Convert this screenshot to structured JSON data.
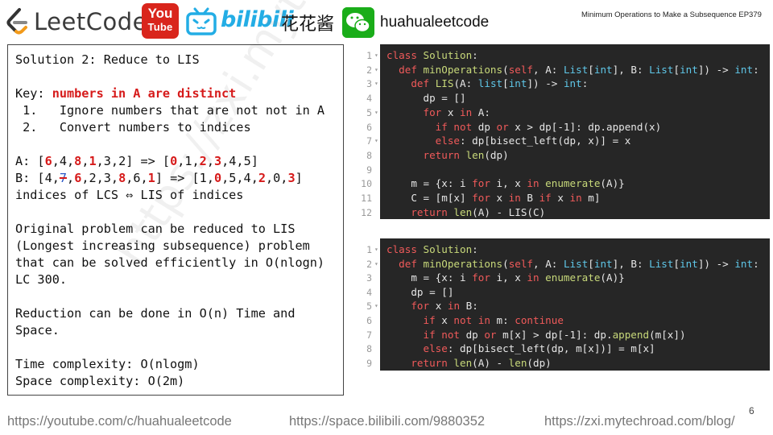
{
  "header": {
    "leetcode_text": "LeetCode",
    "youtube_top": "You",
    "youtube_bottom": "Tube",
    "bilibili_text": "bilibili",
    "channel_name": "花花酱",
    "handle": "huahualeetcode",
    "episode_title": "Minimum Operations to Make a Subsequence EP379"
  },
  "notes": {
    "title": "Solution 2: Reduce to LIS",
    "key_label": "Key: ",
    "key_value": "numbers in A are distinct",
    "step1": " 1.   Ignore numbers that are not not in A",
    "step2": " 2.   Convert numbers to indices",
    "line_a": {
      "p0": "A: [",
      "v0": "6",
      "c0": ",4,",
      "v1": "8",
      "c1": ",",
      "v2": "1",
      "p1": ",3,2] => [",
      "i0": "0",
      "c2": ",1,",
      "i1": "2",
      "c3": ",",
      "i2": "3",
      "p2": ",4,5]"
    },
    "line_b": {
      "p0": "B: [4,",
      "v0": "7",
      "c0": ",",
      "v1": "6",
      "c1": ",2,3,",
      "v2": "8",
      "c2": ",6,",
      "v3": "1",
      "p1": "] => [1,",
      "i0": "0",
      "c3": ",5,4,",
      "i1": "2",
      "c4": ",0,",
      "i2": "3",
      "p2": "]"
    },
    "lcs_line": "indices of LCS ⇔ LIS of indices",
    "para1": [
      "Original problem can be reduced to LIS",
      "(Longest increasing subsequence) problem",
      "that can be solved efficiently in O(nlogn)",
      "LC 300."
    ],
    "para2": [
      "Reduction can be done in O(n) Time and",
      "Space."
    ],
    "time": "Time complexity: O(nlogm)",
    "space": "Space complexity: O(2m)"
  },
  "watermark": "https://zxi.mytechroad.com 花花酱 LeetCode",
  "code1": {
    "line_numbers": [
      "1",
      "2",
      "3",
      "4",
      "5",
      "6",
      "7",
      "8",
      "9",
      "10",
      "11",
      "12"
    ],
    "lines": [
      [
        [
          "kw",
          "class "
        ],
        [
          "fn",
          "Solution"
        ],
        [
          "pl",
          ":"
        ]
      ],
      [
        [
          "pl",
          "  "
        ],
        [
          "kw",
          "def "
        ],
        [
          "fn",
          "minOperations"
        ],
        [
          "pl",
          "("
        ],
        [
          "kw",
          "self"
        ],
        [
          "pl",
          ", A: "
        ],
        [
          "ty",
          "List"
        ],
        [
          "pl",
          "["
        ],
        [
          "ty",
          "int"
        ],
        [
          "pl",
          "], B: "
        ],
        [
          "ty",
          "List"
        ],
        [
          "pl",
          "["
        ],
        [
          "ty",
          "int"
        ],
        [
          "pl",
          "]) -> "
        ],
        [
          "ty",
          "int"
        ],
        [
          "pl",
          ":"
        ]
      ],
      [
        [
          "pl",
          "    "
        ],
        [
          "kw",
          "def "
        ],
        [
          "fn",
          "LIS"
        ],
        [
          "pl",
          "(A: "
        ],
        [
          "ty",
          "list"
        ],
        [
          "pl",
          "["
        ],
        [
          "ty",
          "int"
        ],
        [
          "pl",
          "]) -> "
        ],
        [
          "ty",
          "int"
        ],
        [
          "pl",
          ":"
        ]
      ],
      [
        [
          "pl",
          "      dp = []"
        ]
      ],
      [
        [
          "pl",
          "      "
        ],
        [
          "kw",
          "for "
        ],
        [
          "pl",
          "x "
        ],
        [
          "kw",
          "in "
        ],
        [
          "pl",
          "A:"
        ]
      ],
      [
        [
          "pl",
          "        "
        ],
        [
          "kw",
          "if not "
        ],
        [
          "pl",
          "dp "
        ],
        [
          "kw",
          "or "
        ],
        [
          "pl",
          "x > dp[-1]: dp.append(x)"
        ]
      ],
      [
        [
          "pl",
          "        "
        ],
        [
          "kw",
          "else"
        ],
        [
          "pl",
          ": dp[bisect_left(dp, x)] = x"
        ]
      ],
      [
        [
          "pl",
          "      "
        ],
        [
          "kw",
          "return "
        ],
        [
          "fn",
          "len"
        ],
        [
          "pl",
          "(dp)"
        ]
      ],
      [
        [
          "pl",
          ""
        ]
      ],
      [
        [
          "pl",
          "    m = {x: i "
        ],
        [
          "kw",
          "for "
        ],
        [
          "pl",
          "i, x "
        ],
        [
          "kw",
          "in "
        ],
        [
          "fn",
          "enumerate"
        ],
        [
          "pl",
          "(A)}"
        ]
      ],
      [
        [
          "pl",
          "    C = [m[x] "
        ],
        [
          "kw",
          "for "
        ],
        [
          "pl",
          "x "
        ],
        [
          "kw",
          "in "
        ],
        [
          "pl",
          "B "
        ],
        [
          "kw",
          "if "
        ],
        [
          "pl",
          "x "
        ],
        [
          "kw",
          "in "
        ],
        [
          "pl",
          "m]"
        ]
      ],
      [
        [
          "pl",
          "    "
        ],
        [
          "kw",
          "return "
        ],
        [
          "fn",
          "len"
        ],
        [
          "pl",
          "(A) - LIS(C)"
        ]
      ]
    ]
  },
  "code2": {
    "line_numbers": [
      "1",
      "2",
      "3",
      "4",
      "5",
      "6",
      "7",
      "8",
      "9"
    ],
    "lines": [
      [
        [
          "kw",
          "class "
        ],
        [
          "fn",
          "Solution"
        ],
        [
          "pl",
          ":"
        ]
      ],
      [
        [
          "pl",
          "  "
        ],
        [
          "kw",
          "def "
        ],
        [
          "fn",
          "minOperations"
        ],
        [
          "pl",
          "("
        ],
        [
          "kw",
          "self"
        ],
        [
          "pl",
          ", A: "
        ],
        [
          "ty",
          "List"
        ],
        [
          "pl",
          "["
        ],
        [
          "ty",
          "int"
        ],
        [
          "pl",
          "], B: "
        ],
        [
          "ty",
          "List"
        ],
        [
          "pl",
          "["
        ],
        [
          "ty",
          "int"
        ],
        [
          "pl",
          "]) -> "
        ],
        [
          "ty",
          "int"
        ],
        [
          "pl",
          ":"
        ]
      ],
      [
        [
          "pl",
          "    m = {x: i "
        ],
        [
          "kw",
          "for "
        ],
        [
          "pl",
          "i, x "
        ],
        [
          "kw",
          "in "
        ],
        [
          "fn",
          "enumerate"
        ],
        [
          "pl",
          "(A)}"
        ]
      ],
      [
        [
          "pl",
          "    dp = []"
        ]
      ],
      [
        [
          "pl",
          "    "
        ],
        [
          "kw",
          "for "
        ],
        [
          "pl",
          "x "
        ],
        [
          "kw",
          "in "
        ],
        [
          "pl",
          "B:"
        ]
      ],
      [
        [
          "pl",
          "      "
        ],
        [
          "kw",
          "if "
        ],
        [
          "pl",
          "x "
        ],
        [
          "kw",
          "not in "
        ],
        [
          "pl",
          "m: "
        ],
        [
          "kw",
          "continue"
        ]
      ],
      [
        [
          "pl",
          "      "
        ],
        [
          "kw",
          "if not "
        ],
        [
          "pl",
          "dp "
        ],
        [
          "kw",
          "or "
        ],
        [
          "pl",
          "m[x] > dp[-1]: dp."
        ],
        [
          "fn",
          "append"
        ],
        [
          "pl",
          "(m[x])"
        ]
      ],
      [
        [
          "pl",
          "      "
        ],
        [
          "kw",
          "else"
        ],
        [
          "pl",
          ": dp[bisect_left(dp, m[x])] = m[x]"
        ]
      ],
      [
        [
          "pl",
          "    "
        ],
        [
          "kw",
          "return "
        ],
        [
          "fn",
          "len"
        ],
        [
          "pl",
          "(A) - "
        ],
        [
          "fn",
          "len"
        ],
        [
          "pl",
          "(dp)"
        ]
      ]
    ]
  },
  "footer": {
    "youtube": "https://youtube.com/c/huahualeetcode",
    "bilibili": "https://space.bilibili.com/9880352",
    "blog": "https://zxi.mytechroad.com/blog/",
    "page": "6"
  }
}
